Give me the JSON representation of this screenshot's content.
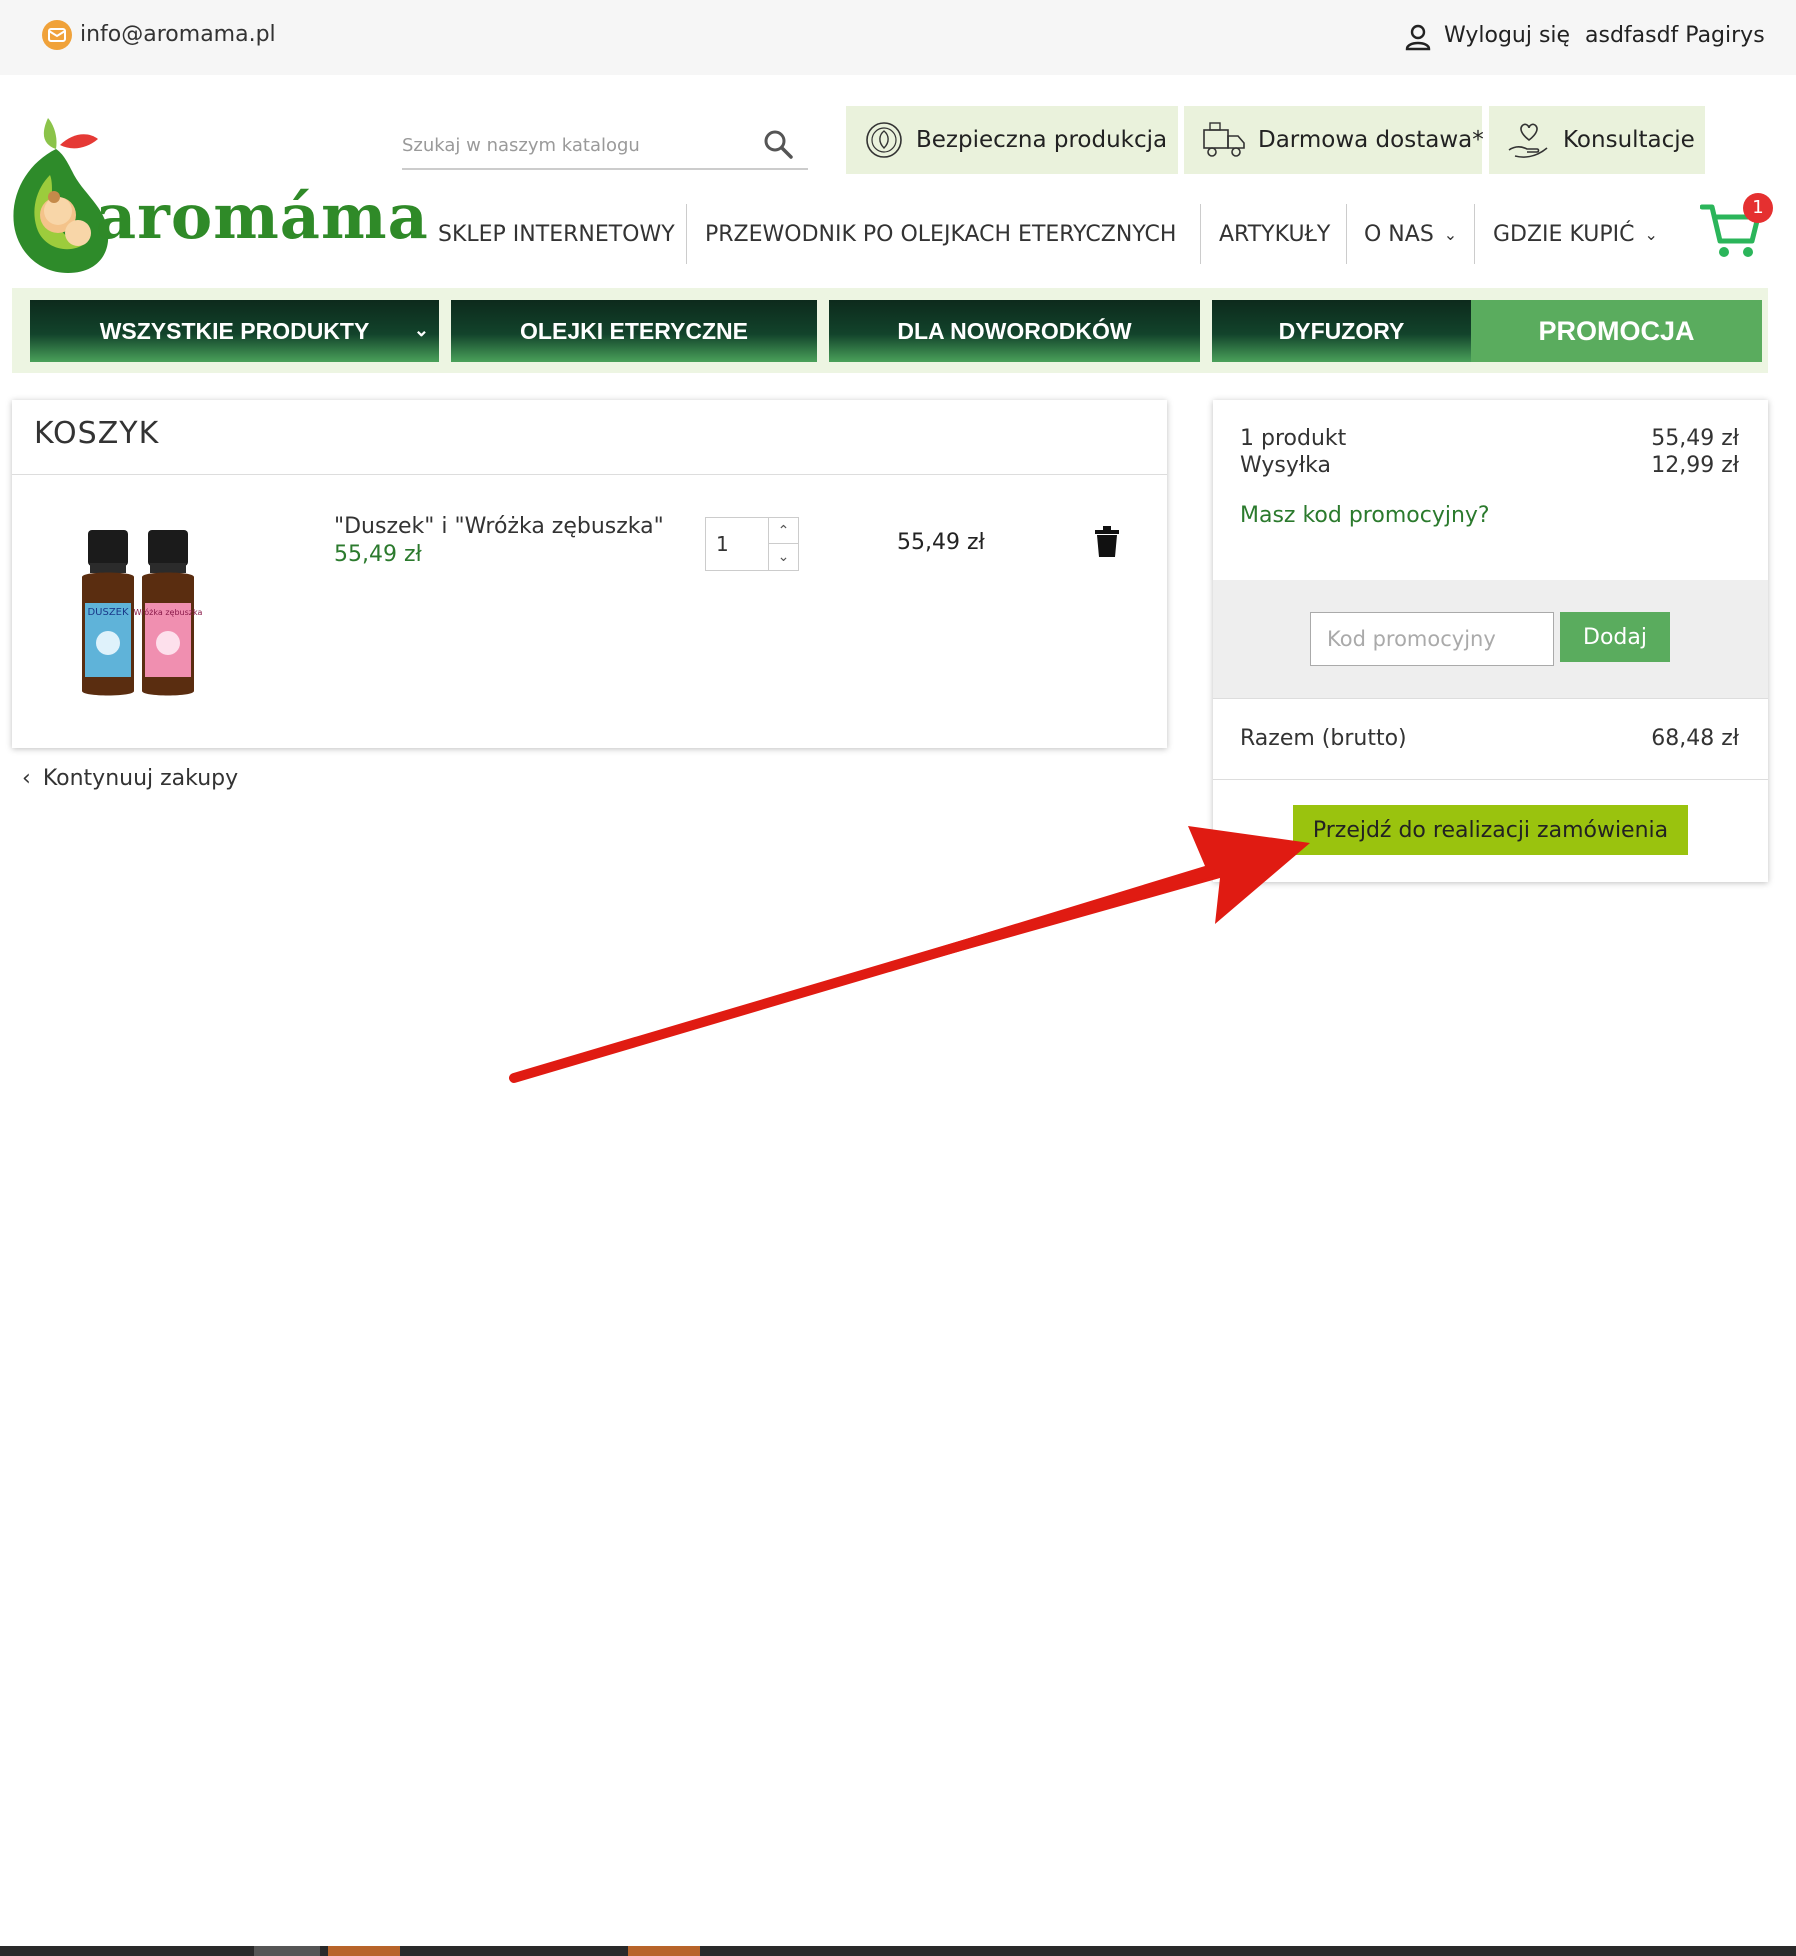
{
  "topbar": {
    "email": "info@aromama.pl",
    "logout_label": "Wyloguj się",
    "user_name": "asdfasdf Pagirys"
  },
  "header": {
    "logo_text": "aromáma",
    "search_placeholder": "Szukaj w naszym katalogu",
    "features": [
      "Bezpieczna produkcja",
      "Darmowa dostawa*",
      "Konsultacje"
    ],
    "nav": [
      "SKLEP INTERNETOWY",
      "PRZEWODNIK PO OLEJKACH ETERYCZNYCH",
      "ARTYKUŁY",
      "O NAS",
      "GDZIE KUPIĆ"
    ],
    "cart_count": "1"
  },
  "categories": [
    "WSZYSTKIE PRODUKTY",
    "OLEJKI ETERYCZNE",
    "DLA NOWORODKÓW",
    "DYFUZORY",
    "PROMOCJA"
  ],
  "cart": {
    "title": "KOSZYK",
    "item": {
      "name": "\"Duszek\" i \"Wróżka zębuszka\"",
      "price": "55,49 zł",
      "quantity": "1",
      "total": "55,49 zł",
      "label_left": "DUSZEK",
      "label_right": "Wróżka zębuszka"
    },
    "continue_label": "Kontynuuj zakupy"
  },
  "summary": {
    "products_label": "1 produkt",
    "products_value": "55,49 zł",
    "shipping_label": "Wysyłka",
    "shipping_value": "12,99 zł",
    "promo_question": "Masz kod promocyjny?",
    "promo_placeholder": "Kod promocyjny",
    "promo_button": "Dodaj",
    "total_label": "Razem (brutto)",
    "total_value": "68,48 zł",
    "checkout_button": "Przejdź do realizacji zamówienia"
  },
  "colors": {
    "accent_green": "#5aac5e",
    "checkout_green": "#9ac30e",
    "price_green": "#2b7a2d",
    "badge_red": "#e53030",
    "annotation_arrow": "#e01b12"
  }
}
